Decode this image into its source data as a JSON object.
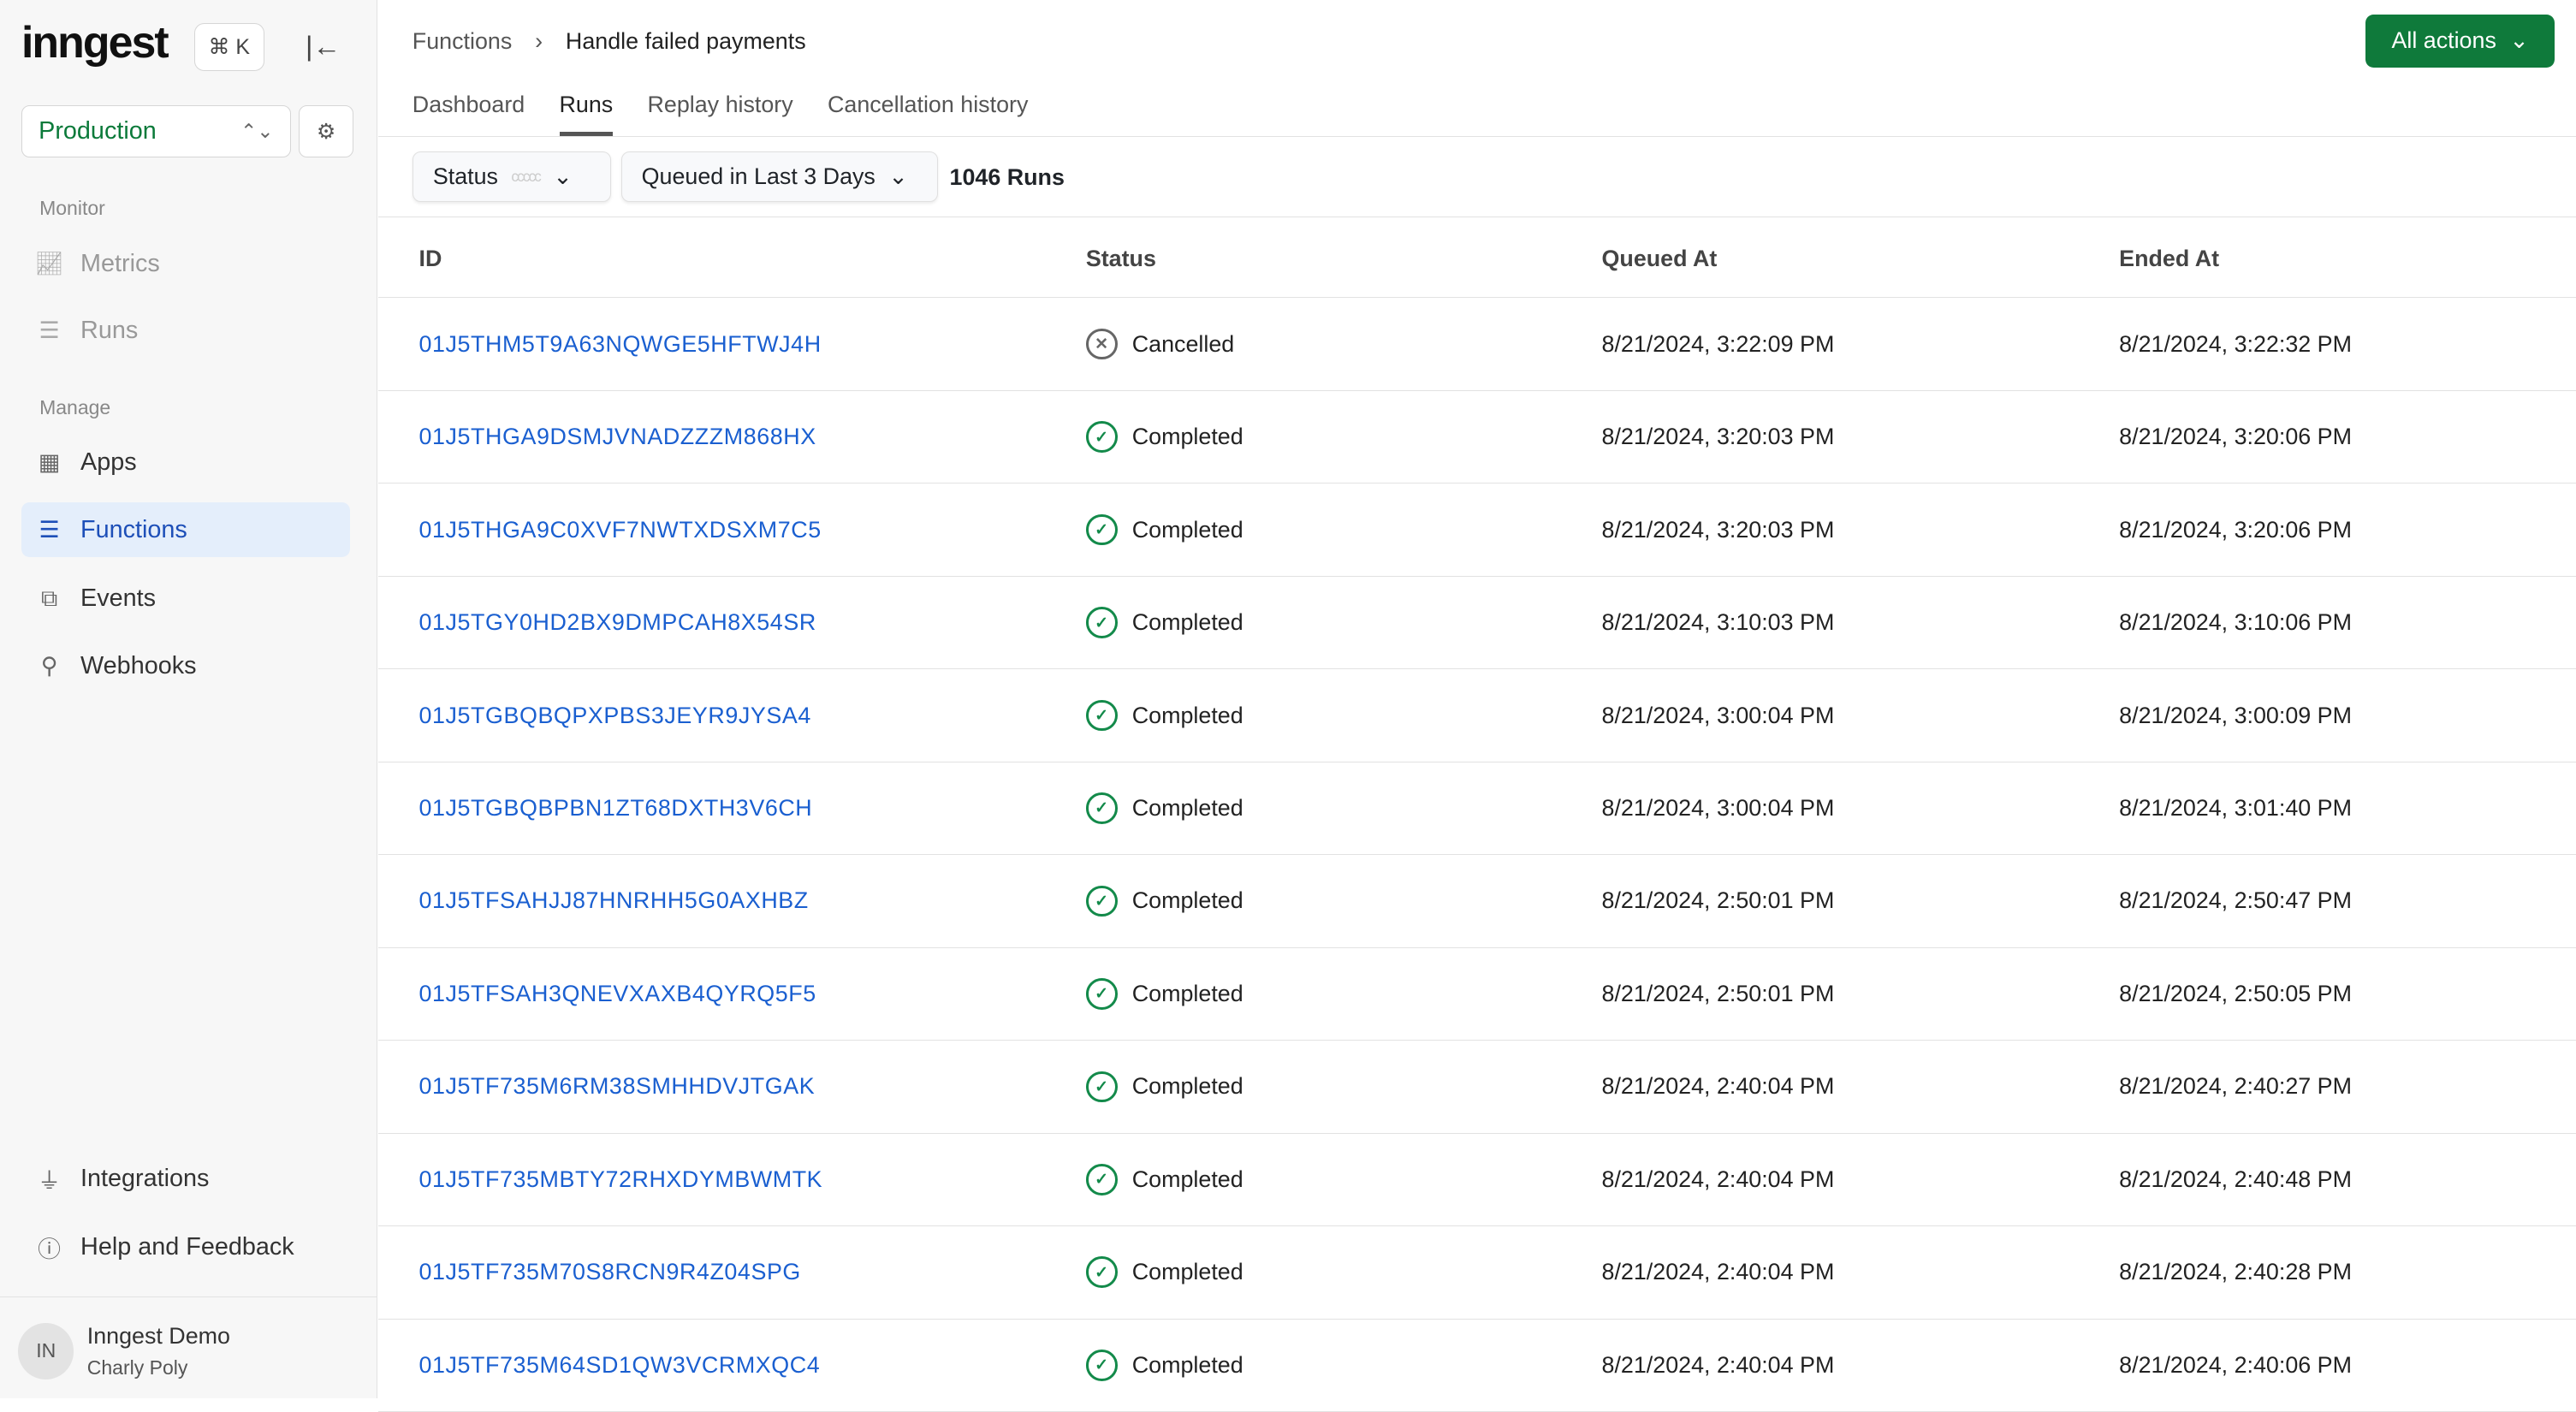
{
  "sidebar": {
    "logo": "inngest",
    "shortcut": "⌘ K",
    "environment": "Production",
    "sections": {
      "monitor": "Monitor",
      "manage": "Manage"
    },
    "items": [
      {
        "label": "Metrics"
      },
      {
        "label": "Runs"
      },
      {
        "label": "Apps"
      },
      {
        "label": "Functions"
      },
      {
        "label": "Events"
      },
      {
        "label": "Webhooks"
      },
      {
        "label": "Integrations"
      },
      {
        "label": "Help and Feedback"
      }
    ],
    "user": {
      "initials": "IN",
      "name": "Inngest Demo",
      "sub": "Charly Poly"
    }
  },
  "header": {
    "breadcrumb": [
      "Functions",
      "Handle failed payments"
    ],
    "all_actions": "All actions"
  },
  "tabs": [
    "Dashboard",
    "Runs",
    "Replay history",
    "Cancellation history"
  ],
  "filters": {
    "status": "Status",
    "status_dots": "ccccc",
    "time": "Queued in Last 3 Days",
    "count": "1046 Runs"
  },
  "table": {
    "columns": [
      "ID",
      "Status",
      "Queued At",
      "Ended At"
    ],
    "rows": [
      {
        "id": "01J5THM5T9A63NQWGE5HFTWJ4H",
        "status": "Cancelled",
        "queued": "8/21/2024, 3:22:09 PM",
        "ended": "8/21/2024, 3:22:32 PM"
      },
      {
        "id": "01J5THGA9DSMJVNADZZZM868HX",
        "status": "Completed",
        "queued": "8/21/2024, 3:20:03 PM",
        "ended": "8/21/2024, 3:20:06 PM"
      },
      {
        "id": "01J5THGA9C0XVF7NWTXDSXM7C5",
        "status": "Completed",
        "queued": "8/21/2024, 3:20:03 PM",
        "ended": "8/21/2024, 3:20:06 PM"
      },
      {
        "id": "01J5TGY0HD2BX9DMPCAH8X54SR",
        "status": "Completed",
        "queued": "8/21/2024, 3:10:03 PM",
        "ended": "8/21/2024, 3:10:06 PM"
      },
      {
        "id": "01J5TGBQBQPXPBS3JEYR9JYSA4",
        "status": "Completed",
        "queued": "8/21/2024, 3:00:04 PM",
        "ended": "8/21/2024, 3:00:09 PM"
      },
      {
        "id": "01J5TGBQBPBN1ZT68DXTH3V6CH",
        "status": "Completed",
        "queued": "8/21/2024, 3:00:04 PM",
        "ended": "8/21/2024, 3:01:40 PM"
      },
      {
        "id": "01J5TFSAHJJ87HNRHH5G0AXHBZ",
        "status": "Completed",
        "queued": "8/21/2024, 2:50:01 PM",
        "ended": "8/21/2024, 2:50:47 PM"
      },
      {
        "id": "01J5TFSAH3QNEVXAXB4QYRQ5F5",
        "status": "Completed",
        "queued": "8/21/2024, 2:50:01 PM",
        "ended": "8/21/2024, 2:50:05 PM"
      },
      {
        "id": "01J5TF735M6RM38SMHHDVJTGAK",
        "status": "Completed",
        "queued": "8/21/2024, 2:40:04 PM",
        "ended": "8/21/2024, 2:40:27 PM"
      },
      {
        "id": "01J5TF735MBTY72RHXDYMBWMTK",
        "status": "Completed",
        "queued": "8/21/2024, 2:40:04 PM",
        "ended": "8/21/2024, 2:40:48 PM"
      },
      {
        "id": "01J5TF735M70S8RCN9R4Z04SPG",
        "status": "Completed",
        "queued": "8/21/2024, 2:40:04 PM",
        "ended": "8/21/2024, 2:40:28 PM"
      },
      {
        "id": "01J5TF735M64SD1QW3VCRMXQC4",
        "status": "Completed",
        "queued": "8/21/2024, 2:40:04 PM",
        "ended": "8/21/2024, 2:40:06 PM"
      }
    ]
  }
}
